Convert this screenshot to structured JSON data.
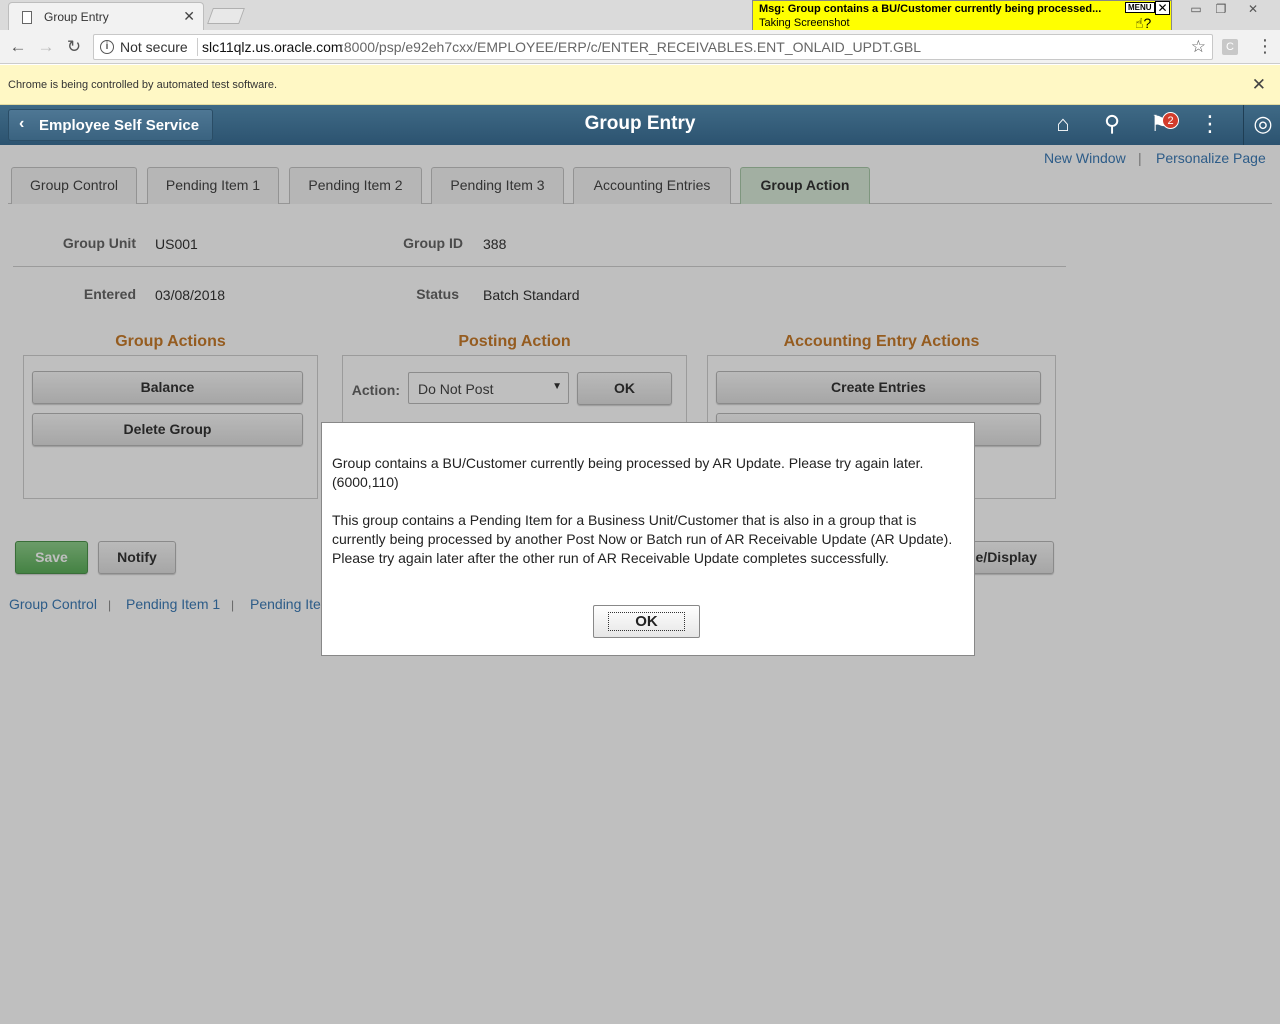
{
  "browser": {
    "tab_title": "Group Entry",
    "tab_close": "✕",
    "security": "Not secure",
    "url_host": "slc11qlz.us.oracle.com",
    "url_path": ":8000/psp/e92eh7cxx/EMPLOYEE/ERP/c/ENTER_RECEIVABLES.ENT_ONLAID_UPDT.GBL",
    "infobar_message": "Chrome is being controlled by automated test software.",
    "ext_letter": "C"
  },
  "tooltip": {
    "line1": "Msg: Group contains a BU/Customer currently being processed...",
    "line2": "Taking Screenshot",
    "menu_label": "MENU"
  },
  "header": {
    "back_label": "Employee Self Service",
    "title": "Group Entry",
    "notification_count": "2"
  },
  "toplinks": {
    "new_window": "New Window",
    "personalize": "Personalize Page"
  },
  "tabs": [
    {
      "label": "Group Control",
      "active": false
    },
    {
      "label": "Pending Item 1",
      "active": false
    },
    {
      "label": "Pending Item 2",
      "active": false
    },
    {
      "label": "Pending Item 3",
      "active": false
    },
    {
      "label": "Accounting Entries",
      "active": false
    },
    {
      "label": "Group Action",
      "active": true
    }
  ],
  "fields": {
    "group_unit_label": "Group Unit",
    "group_unit_value": "US001",
    "group_id_label": "Group ID",
    "group_id_value": "388",
    "entered_label": "Entered",
    "entered_value": "03/08/2018",
    "status_label": "Status",
    "status_value": "Batch Standard"
  },
  "group_actions": {
    "title": "Group Actions",
    "balance": "Balance",
    "delete_group": "Delete Group"
  },
  "posting_action": {
    "title": "Posting Action",
    "action_label": "Action:",
    "selected": "Do Not Post",
    "ok": "OK"
  },
  "accounting_actions": {
    "title": "Accounting Entry Actions",
    "create_entries": "Create Entries",
    "display_partial": "e/Display"
  },
  "footer_buttons": {
    "save": "Save",
    "notify": "Notify"
  },
  "bottom_links": [
    "Group Control",
    "Pending Item 1",
    "Pending Ite"
  ],
  "dialog": {
    "message1": "Group contains a BU/Customer currently being processed by AR Update.  Please try again later. (6000,110)",
    "message2": "This group contains a Pending Item for a Business Unit/Customer that is also in a group that is currently being processed by another Post Now or Batch run of AR Receivable Update (AR Update).  Please try again later after the other run of AR Receivable Update completes successfully.",
    "ok": "OK"
  },
  "colors": {
    "header_bg": "#2c5370",
    "section_title": "#c77b2b",
    "link": "#3c7bb6",
    "active_tab": "#d8ead8",
    "save_button": "#5cae5a"
  }
}
